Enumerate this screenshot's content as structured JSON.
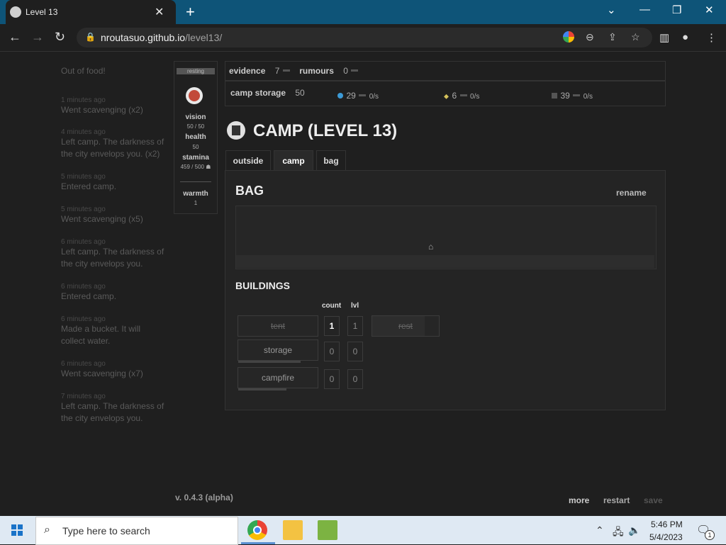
{
  "browser": {
    "tab_title": "Level 13",
    "url_host": "nroutasuo.github.io",
    "url_path": "/level13/"
  },
  "log": [
    {
      "time": "",
      "text": "Out of food!"
    },
    {
      "time": "1 minutes ago",
      "text": "Went scavenging  (x2)"
    },
    {
      "time": "4 minutes ago",
      "text": "Left camp. The darkness of the city envelops you. (x2)"
    },
    {
      "time": "5 minutes ago",
      "text": "Entered camp."
    },
    {
      "time": "5 minutes ago",
      "text": "Went scavenging  (x5)"
    },
    {
      "time": "6 minutes ago",
      "text": "Left camp. The darkness of the city envelops you."
    },
    {
      "time": "6 minutes ago",
      "text": "Entered camp."
    },
    {
      "time": "6 minutes ago",
      "text": "Made a bucket. It will collect water."
    },
    {
      "time": "6 minutes ago",
      "text": "Went scavenging  (x7)"
    },
    {
      "time": "7 minutes ago",
      "text": "Left camp. The darkness of the city envelops you."
    }
  ],
  "status": {
    "badge": "resting",
    "vision_label": "vision",
    "vision_value": "50 / 50",
    "health_label": "health",
    "health_value": "50",
    "stamina_label": "stamina",
    "stamina_value": "459 / 500",
    "warmth_label": "warmth",
    "warmth_value": "1"
  },
  "resources": {
    "evidence_label": "evidence",
    "evidence_value": "7",
    "rumours_label": "rumours",
    "rumours_value": "0",
    "storage_label": "camp storage",
    "storage_value": "50",
    "water_value": "29",
    "water_rate": "0/s",
    "food_value": "6",
    "food_rate": "0/s",
    "metal_value": "39",
    "metal_rate": "0/s"
  },
  "header": {
    "title": "CAMP (LEVEL 13)"
  },
  "tabs": [
    {
      "label": "outside"
    },
    {
      "label": "camp"
    },
    {
      "label": "bag"
    }
  ],
  "bag": {
    "title": "BAG",
    "rename": "rename"
  },
  "buildings": {
    "title": "BUILDINGS",
    "col_count": "count",
    "col_lvl": "lvl",
    "rows": [
      {
        "label": "tent",
        "count": "1",
        "lvl": "1"
      },
      {
        "label": "storage",
        "count": "0",
        "lvl": "0"
      },
      {
        "label": "campfire",
        "count": "0",
        "lvl": "0"
      }
    ],
    "rest_label": "rest"
  },
  "footer": {
    "version": "v. 0.4.3 (alpha)",
    "more": "more",
    "restart": "restart",
    "save": "save"
  },
  "taskbar": {
    "search_placeholder": "Type here to search",
    "time": "5:46 PM",
    "date": "5/4/2023",
    "notification_count": "1"
  },
  "colors": {
    "water_dot": "#3c9ad6",
    "food_icon": "#d4c15a",
    "metal_icon": "#555555"
  }
}
